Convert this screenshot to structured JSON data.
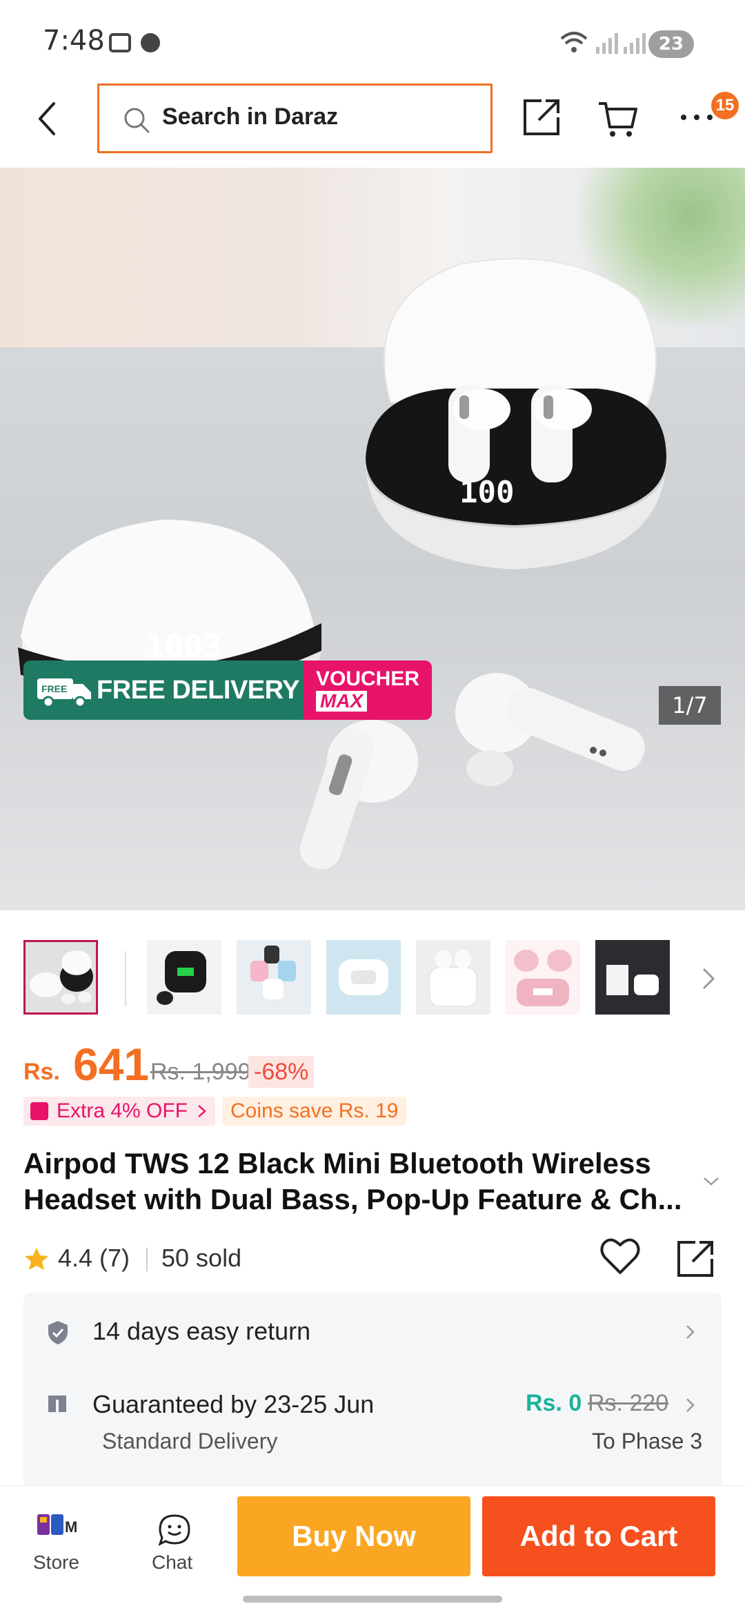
{
  "status_bar": {
    "time": "7:48",
    "battery": "23"
  },
  "header": {
    "search_placeholder": "Search in Daraz",
    "cart_badge": "15"
  },
  "gallery": {
    "promo_delivery": "FREE DELIVERY",
    "promo_voucher_top": "VOUCHER",
    "promo_voucher_bottom": "MAX",
    "counter": "1/7",
    "thumbnail_count": 7
  },
  "price": {
    "currency": "Rs.",
    "current": "641",
    "original": "Rs. 1,999",
    "discount": "-68%",
    "extra_offer": "Extra 4% OFF",
    "coins": "Coins save Rs. 19"
  },
  "product": {
    "title": "Airpod TWS 12 Black Mini Bluetooth Wireless Headset with Dual Bass, Pop-Up Feature & Ch...",
    "rating": "4.4 (7)",
    "sold": "50 sold"
  },
  "service": {
    "return_text": "14 days easy return",
    "delivery_title": "Guaranteed by 23-25 Jun",
    "delivery_sub": "Standard Delivery",
    "shipping_fee": "Rs. 0",
    "shipping_old": "Rs. 220",
    "destination": "To Phase 3"
  },
  "bottom_bar": {
    "store_label": "Store",
    "chat_label": "Chat",
    "buy_now": "Buy Now",
    "add_to_cart": "Add to Cart"
  },
  "colors": {
    "brand_orange": "#f36f21",
    "buy_now": "#fba623",
    "add_to_cart": "#f5501e",
    "voucher_pink": "#e8136a",
    "delivery_green": "#1f7a64",
    "free_shipping_teal": "#1bb39c"
  }
}
